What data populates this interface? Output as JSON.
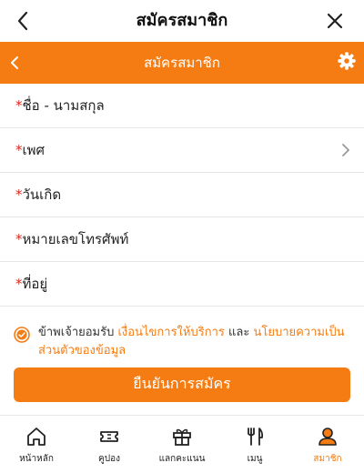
{
  "header": {
    "title": "สมัครสมาชิก"
  },
  "subheader": {
    "title": "สมัครสมาชิก"
  },
  "form": {
    "fields": [
      {
        "required_mark": "*",
        "label": "ชื่อ - นามสกุล"
      },
      {
        "required_mark": "*",
        "label": "เพศ"
      },
      {
        "required_mark": "*",
        "label": "วันเกิด"
      },
      {
        "required_mark": "*",
        "label": "หมายเลขโทรศัพท์"
      },
      {
        "required_mark": "*",
        "label": "ที่อยู่"
      }
    ],
    "consent": {
      "prefix": "ข้าพเจ้ายอมรับ ",
      "terms_link": "เงื่อนไขการให้บริการ",
      "and": " และ ",
      "privacy_link": "นโยบายความเป็นส่วนตัวของข้อมูล",
      "checked": true
    },
    "submit_label": "ยืนยันการสมัคร"
  },
  "tabbar": {
    "items": [
      {
        "label": "หน้าหลัก",
        "icon": "home-icon"
      },
      {
        "label": "คูปอง",
        "icon": "ticket-icon"
      },
      {
        "label": "แลกคะแนน",
        "icon": "gift-icon"
      },
      {
        "label": "เมนู",
        "icon": "utensils-icon"
      },
      {
        "label": "สมาชิก",
        "icon": "user-icon",
        "active": true
      }
    ]
  },
  "colors": {
    "accent": "#f57c12",
    "required": "#d9261c"
  }
}
